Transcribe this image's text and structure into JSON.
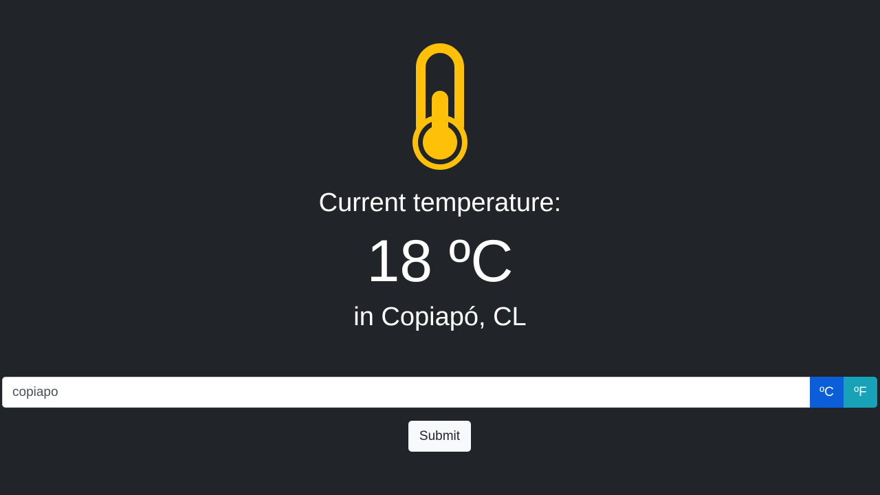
{
  "weather": {
    "label": "Current temperature:",
    "temperature": "18 ºC",
    "location": "in Copiapó, CL"
  },
  "search": {
    "value": "copiapo"
  },
  "units": {
    "celsius_label": "ºC",
    "fahrenheit_label": "ºF",
    "selected": "ºC"
  },
  "actions": {
    "submit_label": "Submit"
  },
  "icon": "thermometer-icon",
  "colors": {
    "background": "#212529",
    "icon": "#ffc107",
    "celsius_button": "#0b5ed7",
    "fahrenheit_button": "#17a2b8",
    "submit_button": "#f8f9fa"
  }
}
